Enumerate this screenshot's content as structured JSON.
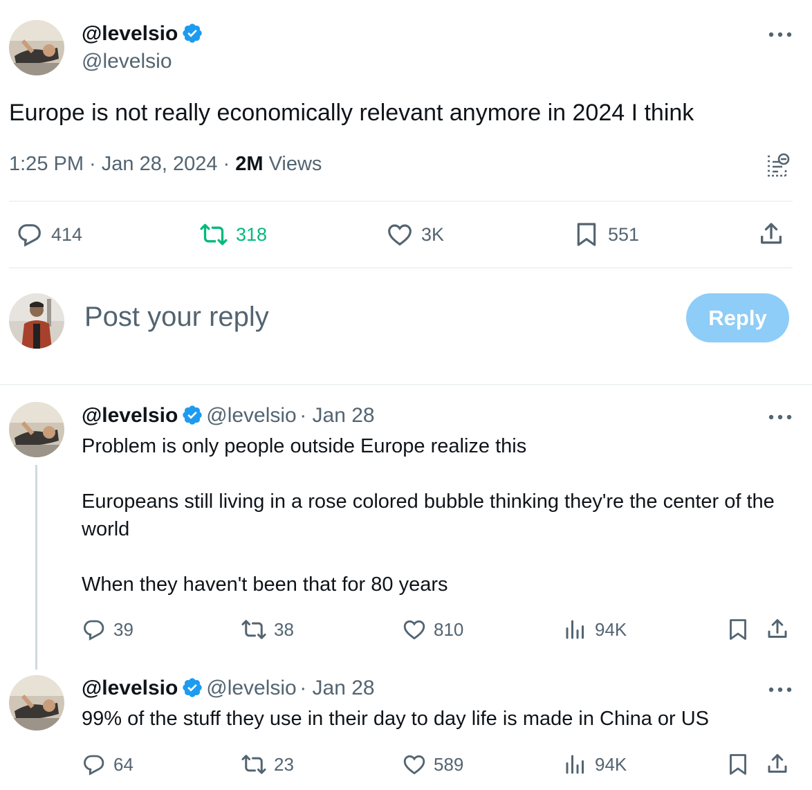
{
  "tweet": {
    "display_name": "@levelsio",
    "handle": "@levelsio",
    "text": "Europe is not really economically relevant anymore in 2024 I think",
    "time": "1:25 PM · Jan 28, 2024 · ",
    "views_count": "2M",
    "views_label": " Views",
    "actions": {
      "replies": "414",
      "reposts": "318",
      "likes": "3K",
      "bookmarks": "551"
    }
  },
  "compose": {
    "placeholder": "Post your reply",
    "button_label": "Reply"
  },
  "replies": [
    {
      "display_name": "@levelsio",
      "handle": "@levelsio",
      "date": "· Jan 28",
      "text": "Problem is only people outside Europe realize this\n\nEuropeans still living in a rose colored bubble thinking they're the center of the world\n\nWhen they haven't been that for 80 years",
      "replies": "39",
      "reposts": "38",
      "likes": "810",
      "views": "94K"
    },
    {
      "display_name": "@levelsio",
      "handle": "@levelsio",
      "date": "· Jan 28",
      "text": "99% of the stuff they use in their day to day life is made in China or US",
      "replies": "64",
      "reposts": "23",
      "likes": "589",
      "views": "94K"
    }
  ],
  "colors": {
    "accent": "#1d9bf0",
    "repost_active": "#00ba7c",
    "secondary_text": "#536471",
    "reply_button_disabled": "#8ecdf8"
  },
  "icons": [
    "verified-badge-icon",
    "more-icon",
    "reply-icon",
    "repost-icon",
    "like-icon",
    "bookmark-icon",
    "share-icon",
    "views-icon",
    "edit-history-icon"
  ]
}
